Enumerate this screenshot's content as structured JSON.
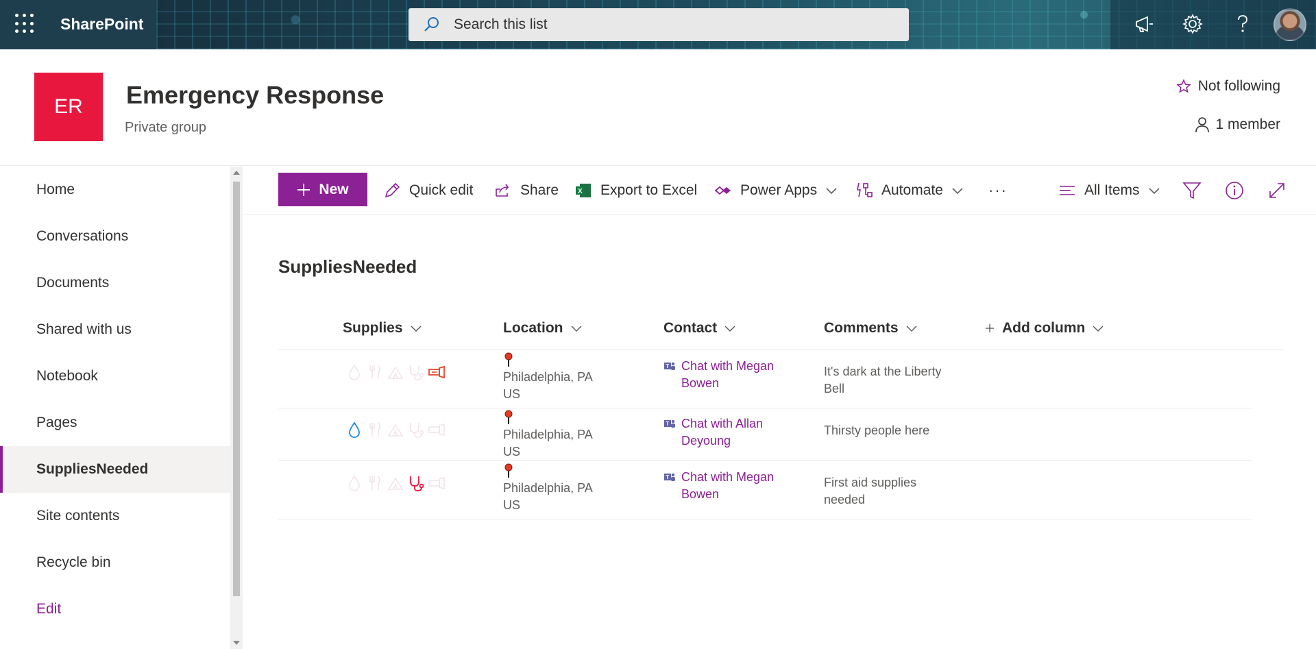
{
  "suitebar": {
    "app_name": "SharePoint",
    "search_placeholder": "Search this list",
    "icons": [
      "waffle-icon",
      "megaphone-icon",
      "gear-icon",
      "help-icon",
      "avatar"
    ]
  },
  "site": {
    "logo_text": "ER",
    "title": "Emergency Response",
    "subtitle": "Private group",
    "follow_label": "Not following",
    "members_label": "1 member",
    "accent_color": "#8c2196",
    "logo_color": "#e8173e"
  },
  "nav": {
    "items": [
      {
        "label": "Home"
      },
      {
        "label": "Conversations"
      },
      {
        "label": "Documents"
      },
      {
        "label": "Shared with us"
      },
      {
        "label": "Notebook"
      },
      {
        "label": "Pages"
      },
      {
        "label": "SuppliesNeeded",
        "selected": true
      },
      {
        "label": "Site contents"
      },
      {
        "label": "Recycle bin"
      }
    ],
    "edit_label": "Edit"
  },
  "commandbar": {
    "new_label": "New",
    "quick_edit": "Quick edit",
    "share": "Share",
    "export": "Export to Excel",
    "power_apps": "Power Apps",
    "automate": "Automate",
    "more": "···",
    "view": "All Items"
  },
  "list": {
    "title": "SuppliesNeeded",
    "columns": {
      "supplies": "Supplies",
      "location": "Location",
      "contact": "Contact",
      "comments": "Comments",
      "add": "Add column"
    },
    "rows": [
      {
        "active_supply": "flashlight",
        "location_line1": "Philadelphia, PA",
        "location_line2": "US",
        "contact_line1": "Chat with Megan",
        "contact_line2": "Bowen",
        "comment_line1": "It's dark at the Liberty",
        "comment_line2": "Bell"
      },
      {
        "active_supply": "water",
        "location_line1": "Philadelphia, PA",
        "location_line2": "US",
        "contact_line1": "Chat with Allan",
        "contact_line2": "Deyoung",
        "comment_line1": "Thirsty people here",
        "comment_line2": ""
      },
      {
        "active_supply": "first-aid",
        "location_line1": "Philadelphia, PA",
        "location_line2": "US",
        "contact_line1": "Chat with Megan",
        "contact_line2": "Bowen",
        "comment_line1": "First aid supplies",
        "comment_line2": "needed"
      }
    ]
  }
}
